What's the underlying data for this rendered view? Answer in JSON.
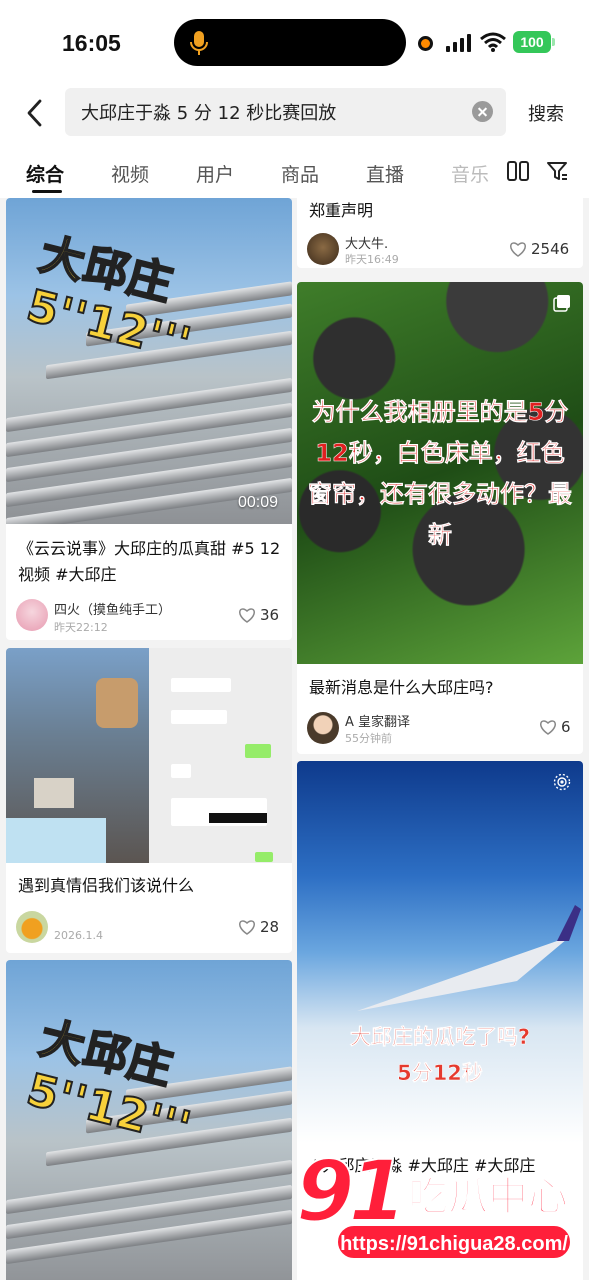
{
  "status_bar": {
    "time": "16:05",
    "battery": "100"
  },
  "search": {
    "query": "大邱庄于淼 5 分 12 秒比赛回放",
    "button": "搜索"
  },
  "tabs": [
    {
      "label": "综合",
      "active": true
    },
    {
      "label": "视频"
    },
    {
      "label": "用户"
    },
    {
      "label": "商品"
    },
    {
      "label": "直播"
    },
    {
      "label": "音乐"
    }
  ],
  "feed": {
    "left": [
      {
        "overlay_text": "大邱庄5''12'''",
        "duration": "00:09",
        "title": "《云云说事》大邱庄的瓜真甜 #5 12 视频 #大邱庄",
        "author": "四火（摸鱼纯手工）",
        "time": "昨天22:12",
        "likes": "36"
      },
      {
        "title": "遇到真情侣我们该说什么",
        "author": "",
        "time": "2026.1.4",
        "likes": "28"
      },
      {
        "overlay_text": "大邱庄5''12'''"
      }
    ],
    "right": [
      {
        "title": "郑重声明",
        "author": "大大牛.",
        "time": "昨天16:49",
        "likes": "2546"
      },
      {
        "overlay_text": "为什么我相册里的是5分12秒，白色床单，红色窗帘，还有很多动作？最新",
        "title": "最新消息是什么大邱庄吗?",
        "author": "A 皇家翻译",
        "time": "55分钟前",
        "likes": "6"
      },
      {
        "overlay_line1": "大邱庄的瓜吃了吗?",
        "overlay_line2": "5分12秒",
        "title": "#大邱庄于淼 #大邱庄 #大邱庄"
      }
    ]
  },
  "watermark": {
    "number": "91",
    "brand": "吃瓜中心",
    "url": "https://91chigua28.com/"
  }
}
